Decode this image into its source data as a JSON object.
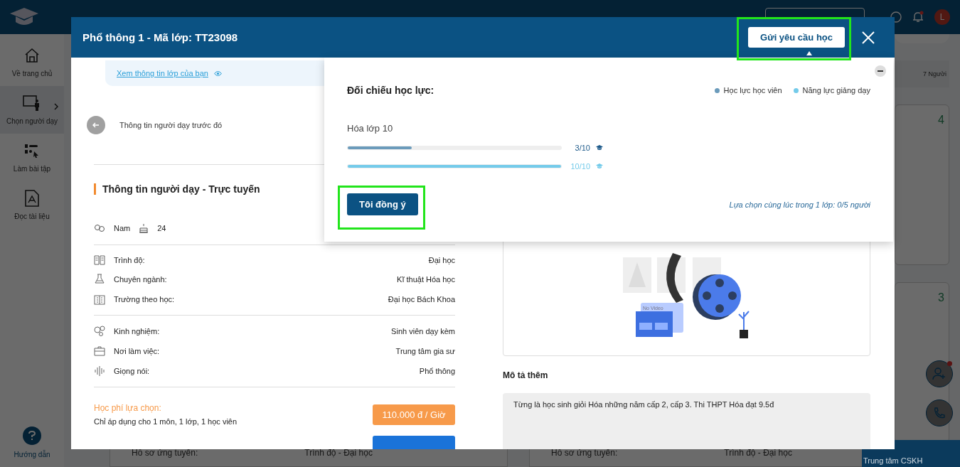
{
  "topbar": {
    "avatar": "L"
  },
  "sidebar": {
    "items": [
      {
        "label": "Về trang chủ",
        "selected": false
      },
      {
        "label": "Chọn người dạy",
        "selected": true
      },
      {
        "label": "Làm bài tập",
        "selected": false
      },
      {
        "label": "Đọc tài liệu",
        "selected": false
      }
    ],
    "help": "Hướng dẫn"
  },
  "background": {
    "count": "7 Người",
    "card_numbers": [
      "4",
      "3"
    ],
    "cards": [
      {
        "label": "Hồ sơ ứng tuyển:",
        "values": [
          "Trình độ - Đại học"
        ]
      },
      {
        "label": "Hồ sơ ứng tuyển:",
        "values": [
          "Trình độ - Đại học"
        ]
      }
    ],
    "support": {
      "subtitle": "Trung tâm CSKH"
    }
  },
  "modal": {
    "title": "Phổ thông 1 - Mã lớp: TT23098",
    "request_button": "Gửi yêu cầu học",
    "info_link": "Xem thông tin lớp của bạn",
    "back_label": "Thông tin người dạy trước đó",
    "section_title": "Thông tin người dạy - Trực tuyến",
    "gender": "Nam",
    "age": "24",
    "groups": [
      [
        {
          "label": "Trình độ:",
          "value": "Đại học"
        },
        {
          "label": "Chuyên ngành:",
          "value": "Kĩ thuật Hóa học"
        },
        {
          "label": "Trường theo học:",
          "value": "Đại học Bách Khoa"
        }
      ],
      [
        {
          "label": "Kinh nghiệm:",
          "value": "Sinh viên dạy kèm"
        },
        {
          "label": "Nơi làm việc:",
          "value": "Trung tâm gia sư"
        },
        {
          "label": "Giọng nói:",
          "value": "Phổ thông"
        }
      ]
    ],
    "fees": [
      {
        "title": "Học phí lựa chọn:",
        "note": "Chỉ áp dụng cho 1 môn, 1 lớp, 1 học viên",
        "price": "110.000 đ / Giờ",
        "color": "#f79a4a"
      },
      {
        "color": "#1a73d9"
      }
    ],
    "video_caption": "No Video",
    "description_title": "Mô tả thêm",
    "description": "Từng là học sinh giỏi Hóa những năm cấp 2, cấp 3. Thi THPT Hóa đạt 9.5đ"
  },
  "popup": {
    "title": "Đối chiếu học lực:",
    "legend": [
      {
        "label": "Học lực học viên",
        "color": "#6b9bbb"
      },
      {
        "label": "Năng lực giảng dạy",
        "color": "#74cbea"
      }
    ],
    "subject": "Hóa lớp 10",
    "bars": [
      {
        "level": 0.3,
        "reading": "3/10",
        "color": "#6b9bbb"
      },
      {
        "level": 1,
        "reading": "10/10",
        "color": "#74cbea"
      }
    ],
    "agree_button": "Tôi đồng ý",
    "note": "Lựa chọn cùng lúc trong 1 lớp: 0/5 người"
  }
}
